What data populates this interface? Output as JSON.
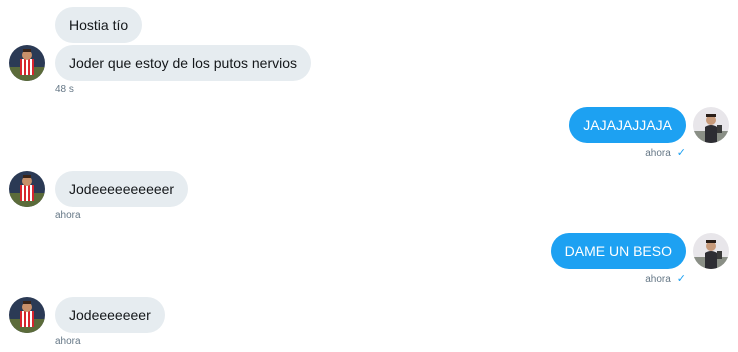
{
  "messages": [
    {
      "text": "Hostia tío",
      "side": "in"
    },
    {
      "text": "Joder que estoy de los putos nervios",
      "side": "in",
      "time": "48 s"
    },
    {
      "text": "JAJAJAJJAJA",
      "side": "out",
      "time": "ahora"
    },
    {
      "text": "Jodeeeeeeeeeer",
      "side": "in",
      "time": "ahora"
    },
    {
      "text": "DAME UN BESO",
      "side": "out",
      "time": "ahora"
    },
    {
      "text": "Jodeeeeeeer",
      "side": "in",
      "time": "ahora"
    }
  ],
  "icons": {
    "read": "checkmark-icon",
    "avatar_in": "football-player-avatar",
    "avatar_out": "person-avatar"
  },
  "colors": {
    "incoming_bubble": "#e6ecf0",
    "outgoing_bubble": "#1da1f2",
    "timestamp": "#657786"
  }
}
